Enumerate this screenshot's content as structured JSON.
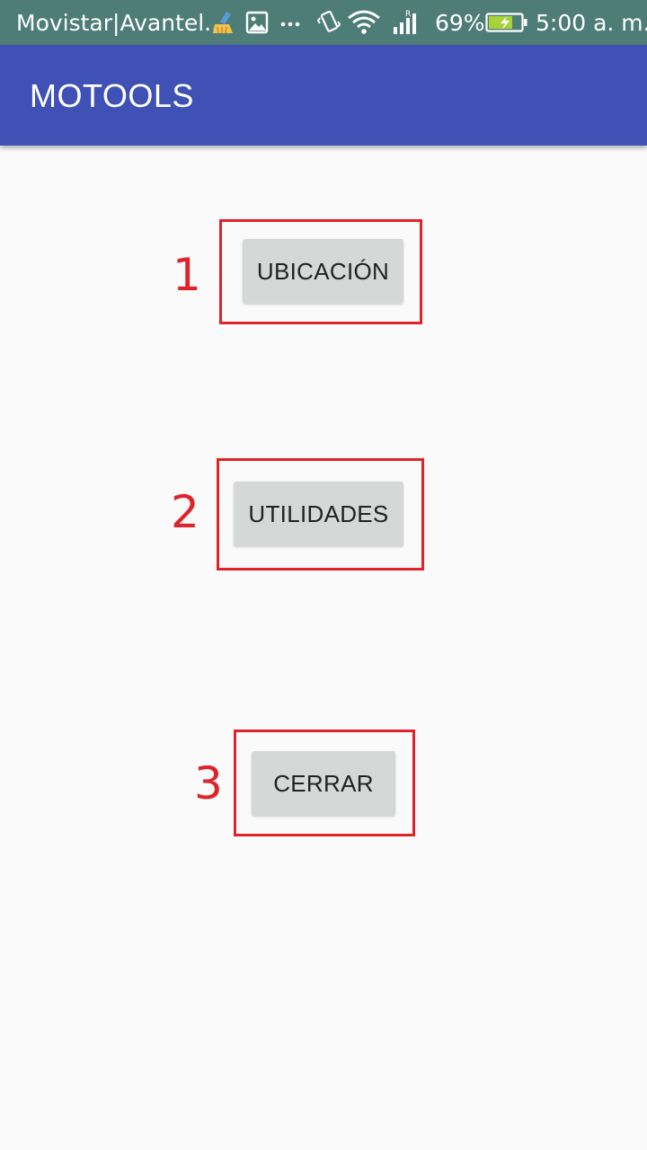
{
  "status_bar": {
    "carrier": "Movistar|Avantel...",
    "battery_percent": "69%",
    "time": "5:00 a. m.",
    "icons": [
      "cleaner-icon",
      "gallery-icon",
      "more-dots-icon",
      "vibrate-icon",
      "wifi-icon",
      "signal-roaming-icon",
      "battery-charging-icon"
    ],
    "roaming_label": "R"
  },
  "app_bar": {
    "title": "MOTOOLS",
    "color": "#3f51b5"
  },
  "buttons": [
    {
      "label": "UBICACIÓN",
      "annotation": "1"
    },
    {
      "label": "UTILIDADES",
      "annotation": "2"
    },
    {
      "label": "CERRAR",
      "annotation": "3"
    }
  ],
  "colors": {
    "annotation_red": "#e0222a",
    "button_gray": "#d6d7d7",
    "background": "#fafafa"
  }
}
